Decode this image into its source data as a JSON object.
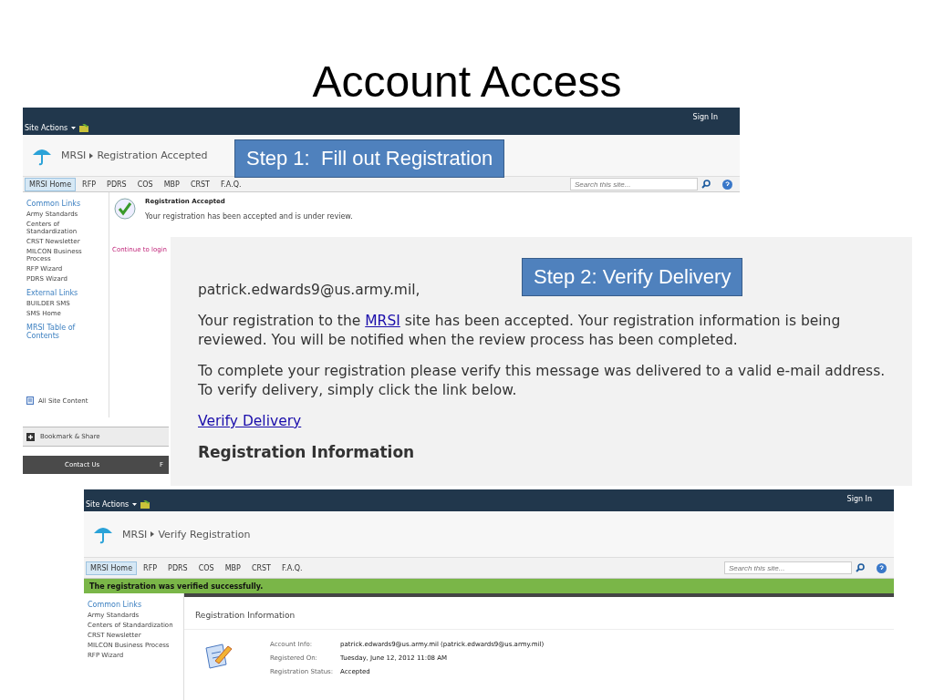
{
  "title": "Account Access",
  "screens": [
    {
      "site_actions": "Site Actions",
      "sign_in": "Sign In",
      "site": "MRSI",
      "page": "Registration Accepted",
      "nav": [
        {
          "label": "MRSI Home",
          "selected": true
        },
        {
          "label": "RFP",
          "selected": false
        },
        {
          "label": "PDRS",
          "selected": false
        },
        {
          "label": "COS",
          "selected": false
        },
        {
          "label": "MBP",
          "selected": false
        },
        {
          "label": "CRST",
          "selected": false
        },
        {
          "label": "F.A.Q.",
          "selected": false
        }
      ],
      "search": {
        "placeholder": "Search this site..."
      },
      "sidebar": [
        {
          "kind": "heading",
          "label": "Common Links"
        },
        {
          "kind": "link",
          "label": "Army Standards"
        },
        {
          "kind": "link",
          "label": "Centers of Standardization"
        },
        {
          "kind": "link",
          "label": "CRST Newsletter"
        },
        {
          "kind": "link",
          "label": "MILCON Business Process"
        },
        {
          "kind": "link",
          "label": "RFP Wizard"
        },
        {
          "kind": "link",
          "label": "PDRS Wizard"
        },
        {
          "kind": "heading",
          "label": "External Links"
        },
        {
          "kind": "link",
          "label": "BUILDER SMS"
        },
        {
          "kind": "link",
          "label": "SMS Home"
        },
        {
          "kind": "heading",
          "label": "MRSI Table of Contents"
        }
      ],
      "all_site_content": "All Site Content",
      "bookmark": "Bookmark & Share",
      "footer": [
        "Contact Us",
        "F"
      ],
      "message_title": "Registration Accepted",
      "message": "Your registration has been accepted and is under review.",
      "continue_link": "Continue to login"
    },
    {
      "site_actions": "Site Actions",
      "sign_in": "Sign In",
      "site": "MRSI",
      "page": "Verify Registration",
      "nav": [
        {
          "label": "MRSI Home",
          "selected": true
        },
        {
          "label": "RFP",
          "selected": false
        },
        {
          "label": "PDRS",
          "selected": false
        },
        {
          "label": "COS",
          "selected": false
        },
        {
          "label": "MBP",
          "selected": false
        },
        {
          "label": "CRST",
          "selected": false
        },
        {
          "label": "F.A.Q.",
          "selected": false
        }
      ],
      "search": {
        "placeholder": "Search this site..."
      },
      "status_banner": "The registration was verified successfully.",
      "sidebar": [
        {
          "kind": "heading",
          "label": "Common Links"
        },
        {
          "kind": "link",
          "label": "Army Standards"
        },
        {
          "kind": "link",
          "label": "Centers of Standardization"
        },
        {
          "kind": "link",
          "label": "CRST Newsletter"
        },
        {
          "kind": "link",
          "label": "MILCON Business Process"
        },
        {
          "kind": "link",
          "label": "RFP Wizard"
        }
      ],
      "section_title": "Registration Information",
      "fields": [
        {
          "label": "Account Info:",
          "value": "patrick.edwards9@us.army.mil (patrick.edwards9@us.army.mil)"
        },
        {
          "label": "Registered On:",
          "value": "Tuesday, June 12, 2012 11:08 AM"
        },
        {
          "label": "Registration Status:",
          "value": "Accepted"
        }
      ]
    }
  ],
  "email": {
    "greeting": "patrick.edwards9@us.army.mil,",
    "para_before_link": "Your registration to the",
    "site_link": "MRSI",
    "para_after_link": "site has been accepted. Your registration information is being reviewed. You will be notified when the review process has been completed.",
    "paragraph_2": "To complete your registration please verify this message was delivered to a valid e-mail address. To verify delivery, simply click the link below.",
    "verify_link": "Verify Delivery",
    "heading": "Registration Information"
  },
  "callouts": [
    "Step 1:  Fill out Registration",
    "Step 2: Verify Delivery"
  ]
}
